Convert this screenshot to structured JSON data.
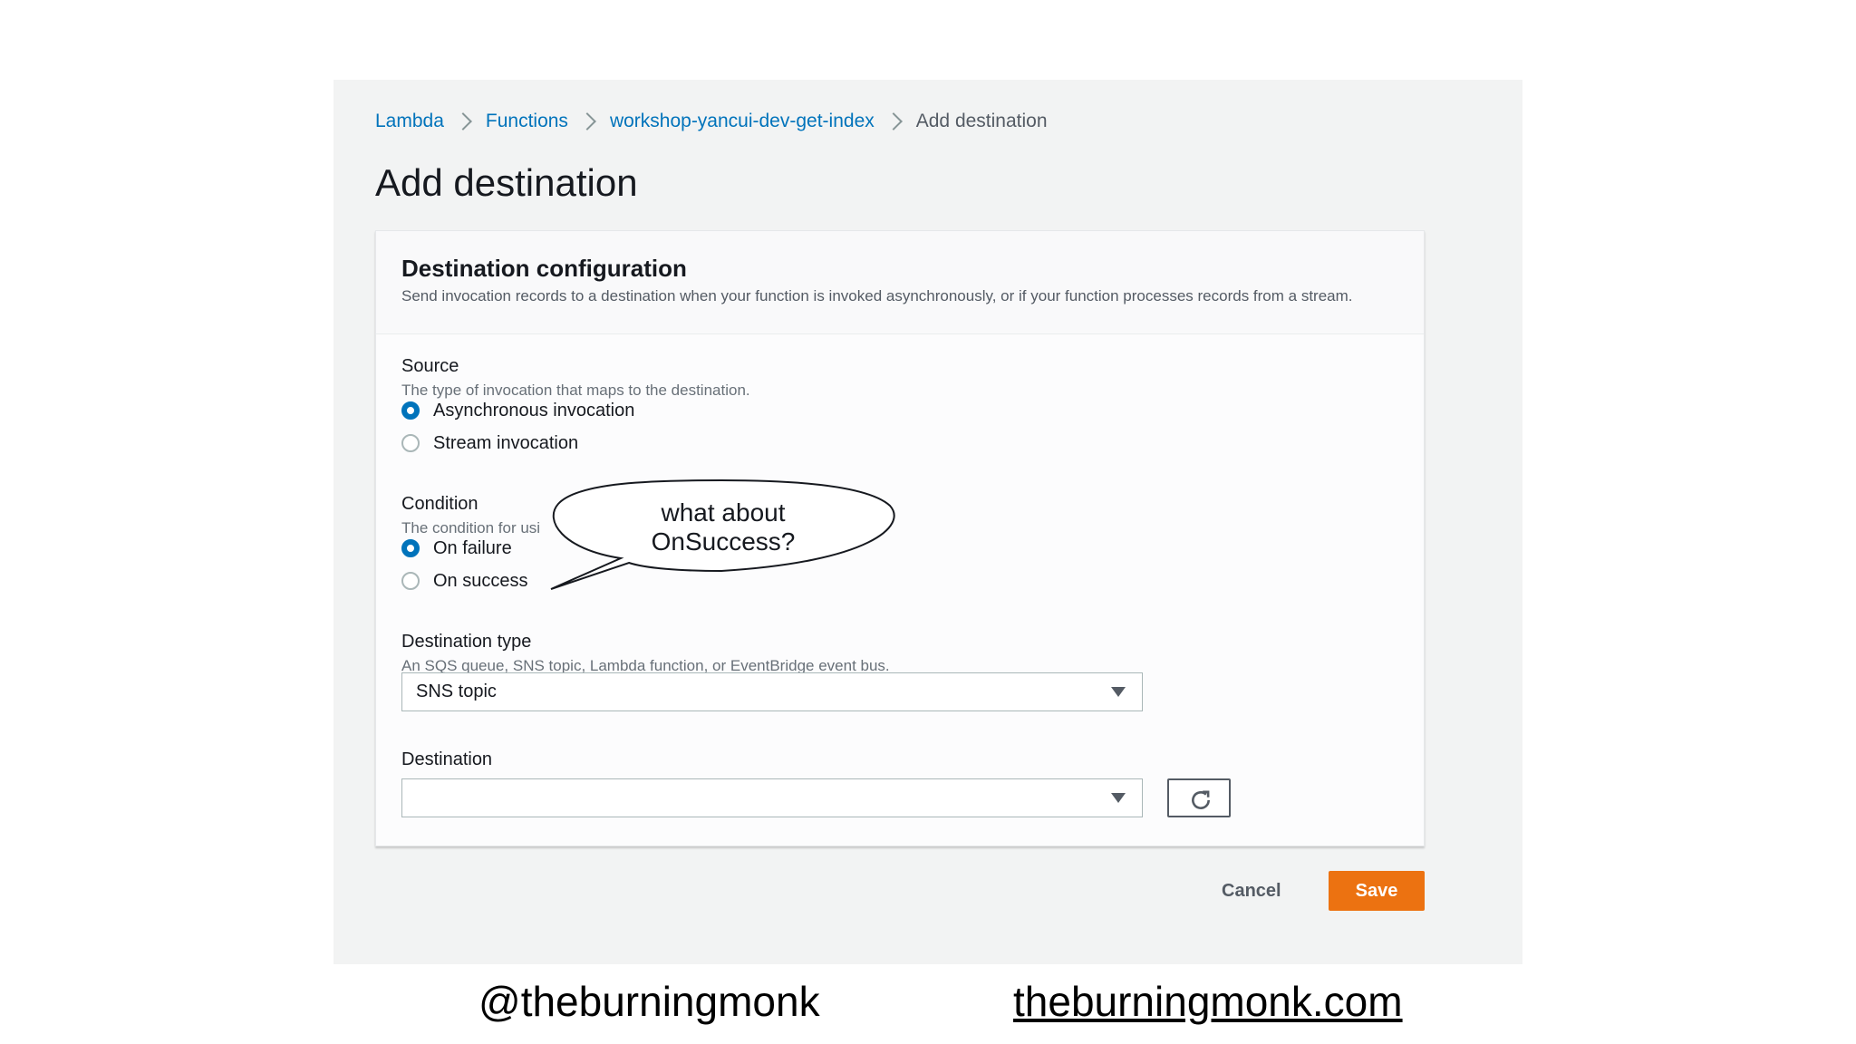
{
  "breadcrumb": {
    "items": [
      "Lambda",
      "Functions",
      "workshop-yancui-dev-get-index"
    ],
    "current": "Add destination"
  },
  "page_title": "Add destination",
  "panel": {
    "title": "Destination configuration",
    "description": "Send invocation records to a destination when your function is invoked asynchronously, or if your function processes records from a stream."
  },
  "source": {
    "label": "Source",
    "description": "The type of invocation that maps to the destination.",
    "options": [
      {
        "label": "Asynchronous invocation",
        "checked": true
      },
      {
        "label": "Stream invocation",
        "checked": false
      }
    ]
  },
  "condition": {
    "label": "Condition",
    "description": "The condition for usi",
    "options": [
      {
        "label": "On failure",
        "checked": true
      },
      {
        "label": "On success",
        "checked": false
      }
    ]
  },
  "destination_type": {
    "label": "Destination type",
    "description": "An SQS queue, SNS topic, Lambda function, or EventBridge event bus.",
    "value": "SNS topic",
    "caret_icon": "caret-down-icon"
  },
  "destination": {
    "label": "Destination",
    "value": "",
    "caret_icon": "caret-down-icon",
    "refresh_icon": "refresh-icon"
  },
  "actions": {
    "cancel_label": "Cancel",
    "save_label": "Save",
    "save_color": "#ec7211"
  },
  "callout": {
    "line1": "what about",
    "line2": "OnSuccess?"
  },
  "footer": {
    "handle": "@theburningmonk",
    "site": "theburningmonk.com"
  },
  "colors": {
    "link": "#0073bb",
    "radio_selected": "#0073bb",
    "background": "#f2f3f3"
  }
}
